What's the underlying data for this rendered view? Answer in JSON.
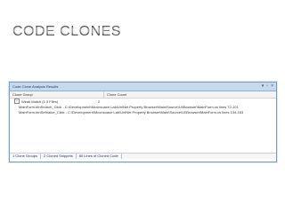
{
  "slide": {
    "title": "Code Clones"
  },
  "window": {
    "title": "Code Clone Analysis Results",
    "controls": [
      "▾",
      "▫",
      "×"
    ]
  },
  "grid": {
    "columns": [
      "Clone Group",
      "Clone Count"
    ],
    "group": {
      "label": "Weak Match (1:3 Files)",
      "count": "2"
    },
    "rows": [
      "MainForm.btnSearch_Click - C:\\Development\\Mconsoace Lab\\UniNet Property Browser\\Main\\Source\\UI\\Browser\\MainForm.cs lines 72-101",
      "MainForm.btnSetValue_Click - C:\\Development\\Mconsoace Lab\\UniNet Property Browser\\Main\\Source\\UI\\Browser\\MainForm.cs lines 134-163"
    ]
  },
  "tabs": [
    "1 Clone Groups",
    "2 Cloned Snippets",
    "80 Lines of Cloned Code"
  ]
}
